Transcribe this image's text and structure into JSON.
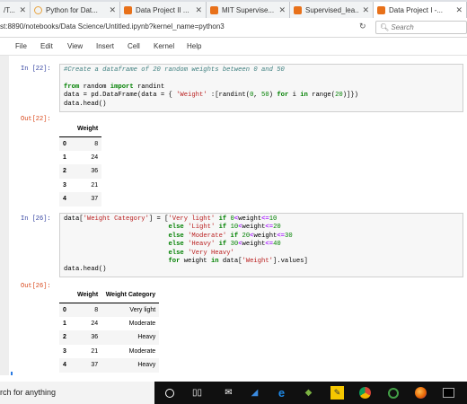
{
  "browser": {
    "tabs": [
      {
        "label": "/T...",
        "icon": "page-icon",
        "color": "#8a8a8a"
      },
      {
        "label": "Python for Dat...",
        "icon": "loading-icon",
        "color": "#e8a33d"
      },
      {
        "label": "Data Project II ...",
        "icon": "orange-page-icon",
        "color": "#e8711a"
      },
      {
        "label": "MIT Supervise...",
        "icon": "orange-page-icon",
        "color": "#e8711a"
      },
      {
        "label": "Supervised_lea...",
        "icon": "orange-page-icon",
        "color": "#e8711a"
      },
      {
        "label": "Data Project I -...",
        "icon": "orange-page-icon",
        "color": "#e8711a"
      }
    ],
    "url": "st:8890/notebooks/Data Science/Untitled.ipynb?kernel_name=python3",
    "search_placeholder": "Search"
  },
  "menu": [
    "File",
    "Edit",
    "View",
    "Insert",
    "Cell",
    "Kernel",
    "Help"
  ],
  "cells": {
    "in22_prompt": "In [22]:",
    "in22_lines": [
      "#Create a dataframe of 20 random weights between 0 and 50",
      "",
      "from random import randint",
      "data = pd.DataFrame(data = { 'Weight' :[randint(0, 50) for i in range(20)]})",
      "data.head()"
    ],
    "out22_prompt": "Out[22]:",
    "out22_table": {
      "columns": [
        "",
        "Weight"
      ],
      "rows": [
        [
          "0",
          "8"
        ],
        [
          "1",
          "24"
        ],
        [
          "2",
          "36"
        ],
        [
          "3",
          "21"
        ],
        [
          "4",
          "37"
        ]
      ]
    },
    "in26_prompt": "In [26]:",
    "in26_lines": [
      "data['Weight Category'] = ['Very light' if 0<weight<=10",
      "                           else 'Light' if 10<weight<=20",
      "                           else 'Moderate' if 20<weight<=30",
      "                           else 'Heavy' if 30<weight<=40",
      "                           else 'Very Heavy'",
      "                           for weight in data['Weight'].values]",
      "data.head()"
    ],
    "out26_prompt": "Out[26]:",
    "out26_table": {
      "columns": [
        "",
        "Weight",
        "Weight Category"
      ],
      "rows": [
        [
          "0",
          "8",
          "Very light"
        ],
        [
          "1",
          "24",
          "Moderate"
        ],
        [
          "2",
          "36",
          "Heavy"
        ],
        [
          "3",
          "21",
          "Moderate"
        ],
        [
          "4",
          "37",
          "Heavy"
        ]
      ]
    }
  },
  "taskbar": {
    "search_text": "rch for anything",
    "icons": [
      "cortana-circle-icon",
      "task-view-icon",
      "mail-icon",
      "edge-icon",
      "app-diamond-icon",
      "sticky-notes-icon",
      "chrome-icon",
      "green-circle-icon",
      "firefox-icon",
      "terminal-icon"
    ]
  }
}
